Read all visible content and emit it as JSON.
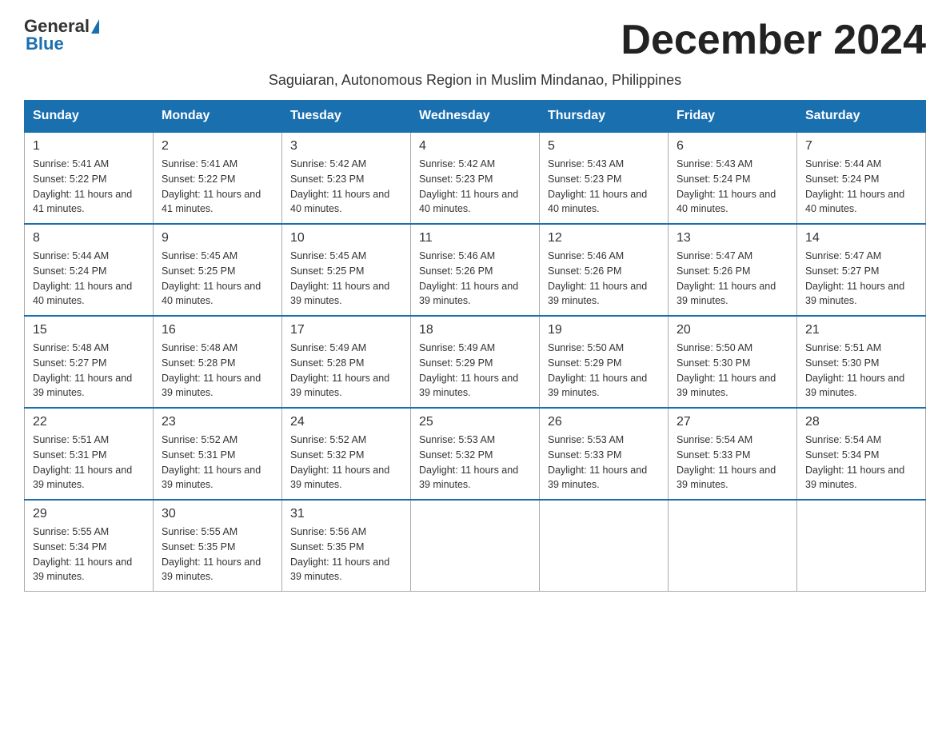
{
  "header": {
    "logo_general": "General",
    "logo_blue": "Blue",
    "month_title": "December 2024",
    "subtitle": "Saguiaran, Autonomous Region in Muslim Mindanao, Philippines"
  },
  "days_of_week": [
    "Sunday",
    "Monday",
    "Tuesday",
    "Wednesday",
    "Thursday",
    "Friday",
    "Saturday"
  ],
  "weeks": [
    [
      {
        "day": "1",
        "sunrise": "5:41 AM",
        "sunset": "5:22 PM",
        "daylight": "11 hours and 41 minutes."
      },
      {
        "day": "2",
        "sunrise": "5:41 AM",
        "sunset": "5:22 PM",
        "daylight": "11 hours and 41 minutes."
      },
      {
        "day": "3",
        "sunrise": "5:42 AM",
        "sunset": "5:23 PM",
        "daylight": "11 hours and 40 minutes."
      },
      {
        "day": "4",
        "sunrise": "5:42 AM",
        "sunset": "5:23 PM",
        "daylight": "11 hours and 40 minutes."
      },
      {
        "day": "5",
        "sunrise": "5:43 AM",
        "sunset": "5:23 PM",
        "daylight": "11 hours and 40 minutes."
      },
      {
        "day": "6",
        "sunrise": "5:43 AM",
        "sunset": "5:24 PM",
        "daylight": "11 hours and 40 minutes."
      },
      {
        "day": "7",
        "sunrise": "5:44 AM",
        "sunset": "5:24 PM",
        "daylight": "11 hours and 40 minutes."
      }
    ],
    [
      {
        "day": "8",
        "sunrise": "5:44 AM",
        "sunset": "5:24 PM",
        "daylight": "11 hours and 40 minutes."
      },
      {
        "day": "9",
        "sunrise": "5:45 AM",
        "sunset": "5:25 PM",
        "daylight": "11 hours and 40 minutes."
      },
      {
        "day": "10",
        "sunrise": "5:45 AM",
        "sunset": "5:25 PM",
        "daylight": "11 hours and 39 minutes."
      },
      {
        "day": "11",
        "sunrise": "5:46 AM",
        "sunset": "5:26 PM",
        "daylight": "11 hours and 39 minutes."
      },
      {
        "day": "12",
        "sunrise": "5:46 AM",
        "sunset": "5:26 PM",
        "daylight": "11 hours and 39 minutes."
      },
      {
        "day": "13",
        "sunrise": "5:47 AM",
        "sunset": "5:26 PM",
        "daylight": "11 hours and 39 minutes."
      },
      {
        "day": "14",
        "sunrise": "5:47 AM",
        "sunset": "5:27 PM",
        "daylight": "11 hours and 39 minutes."
      }
    ],
    [
      {
        "day": "15",
        "sunrise": "5:48 AM",
        "sunset": "5:27 PM",
        "daylight": "11 hours and 39 minutes."
      },
      {
        "day": "16",
        "sunrise": "5:48 AM",
        "sunset": "5:28 PM",
        "daylight": "11 hours and 39 minutes."
      },
      {
        "day": "17",
        "sunrise": "5:49 AM",
        "sunset": "5:28 PM",
        "daylight": "11 hours and 39 minutes."
      },
      {
        "day": "18",
        "sunrise": "5:49 AM",
        "sunset": "5:29 PM",
        "daylight": "11 hours and 39 minutes."
      },
      {
        "day": "19",
        "sunrise": "5:50 AM",
        "sunset": "5:29 PM",
        "daylight": "11 hours and 39 minutes."
      },
      {
        "day": "20",
        "sunrise": "5:50 AM",
        "sunset": "5:30 PM",
        "daylight": "11 hours and 39 minutes."
      },
      {
        "day": "21",
        "sunrise": "5:51 AM",
        "sunset": "5:30 PM",
        "daylight": "11 hours and 39 minutes."
      }
    ],
    [
      {
        "day": "22",
        "sunrise": "5:51 AM",
        "sunset": "5:31 PM",
        "daylight": "11 hours and 39 minutes."
      },
      {
        "day": "23",
        "sunrise": "5:52 AM",
        "sunset": "5:31 PM",
        "daylight": "11 hours and 39 minutes."
      },
      {
        "day": "24",
        "sunrise": "5:52 AM",
        "sunset": "5:32 PM",
        "daylight": "11 hours and 39 minutes."
      },
      {
        "day": "25",
        "sunrise": "5:53 AM",
        "sunset": "5:32 PM",
        "daylight": "11 hours and 39 minutes."
      },
      {
        "day": "26",
        "sunrise": "5:53 AM",
        "sunset": "5:33 PM",
        "daylight": "11 hours and 39 minutes."
      },
      {
        "day": "27",
        "sunrise": "5:54 AM",
        "sunset": "5:33 PM",
        "daylight": "11 hours and 39 minutes."
      },
      {
        "day": "28",
        "sunrise": "5:54 AM",
        "sunset": "5:34 PM",
        "daylight": "11 hours and 39 minutes."
      }
    ],
    [
      {
        "day": "29",
        "sunrise": "5:55 AM",
        "sunset": "5:34 PM",
        "daylight": "11 hours and 39 minutes."
      },
      {
        "day": "30",
        "sunrise": "5:55 AM",
        "sunset": "5:35 PM",
        "daylight": "11 hours and 39 minutes."
      },
      {
        "day": "31",
        "sunrise": "5:56 AM",
        "sunset": "5:35 PM",
        "daylight": "11 hours and 39 minutes."
      },
      null,
      null,
      null,
      null
    ]
  ],
  "labels": {
    "sunrise_prefix": "Sunrise: ",
    "sunset_prefix": "Sunset: ",
    "daylight_prefix": "Daylight: "
  }
}
